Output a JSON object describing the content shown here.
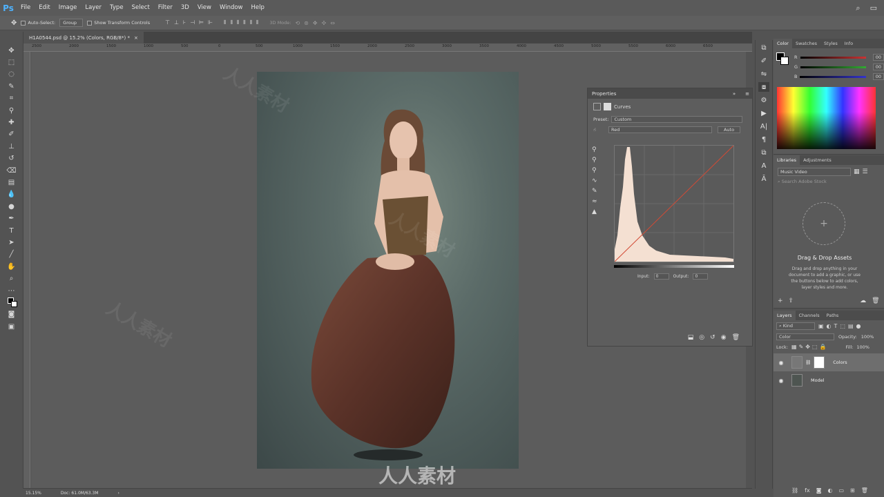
{
  "app": {
    "logo": "Ps"
  },
  "menu": [
    "File",
    "Edit",
    "Image",
    "Layer",
    "Type",
    "Select",
    "Filter",
    "3D",
    "View",
    "Window",
    "Help"
  ],
  "options_bar": {
    "auto_select_label": "Auto-Select:",
    "auto_select_value": "Group",
    "show_transform_label": "Show Transform Controls",
    "mode_3d_label": "3D Mode:"
  },
  "document": {
    "tab_title": "H1A0544.psd @ 15.2% (Colors, RGB/8*) *",
    "close_glyph": "×",
    "ruler_ticks": [
      "2500",
      "2000",
      "1500",
      "1000",
      "500",
      "0",
      "500",
      "1000",
      "1500",
      "2000",
      "2500",
      "3000",
      "3500",
      "4000",
      "4500",
      "5000",
      "5500",
      "6000",
      "6500"
    ]
  },
  "status": {
    "zoom": "15.15%",
    "doc": "Doc: 61.0M/63.3M"
  },
  "properties": {
    "title": "Properties",
    "adjustment": "Curves",
    "preset_label": "Preset:",
    "preset_value": "Custom",
    "channel_value": "Red",
    "auto_label": "Auto",
    "input_label": "Input:",
    "input_value": "0",
    "output_label": "Output:",
    "output_value": "0"
  },
  "color_panel": {
    "tabs": [
      "Color",
      "Swatches",
      "Styles",
      "Info"
    ],
    "channels": [
      {
        "name": "R",
        "value": "00"
      },
      {
        "name": "G",
        "value": "00"
      },
      {
        "name": "B",
        "value": "00"
      }
    ]
  },
  "libraries": {
    "tabs": [
      "Libraries",
      "Adjustments"
    ],
    "library_value": "Music Video",
    "search_placeholder": "Search Adobe Stock",
    "drop_title": "Drag & Drop Assets",
    "drop_text": "Drag and drop anything in your document to add a graphic, or use the buttons below to add colors, layer styles and more."
  },
  "layers": {
    "tabs": [
      "Layers",
      "Channels",
      "Paths"
    ],
    "filter_value": "Kind",
    "blend_mode": "Color",
    "opacity_label": "Opacity:",
    "opacity_value": "100%",
    "lock_label": "Lock:",
    "fill_label": "Fill:",
    "fill_value": "100%",
    "items": [
      {
        "name": "Colors",
        "selected": true
      },
      {
        "name": "Model",
        "selected": false
      }
    ]
  },
  "watermark": {
    "text": "人人素材"
  }
}
